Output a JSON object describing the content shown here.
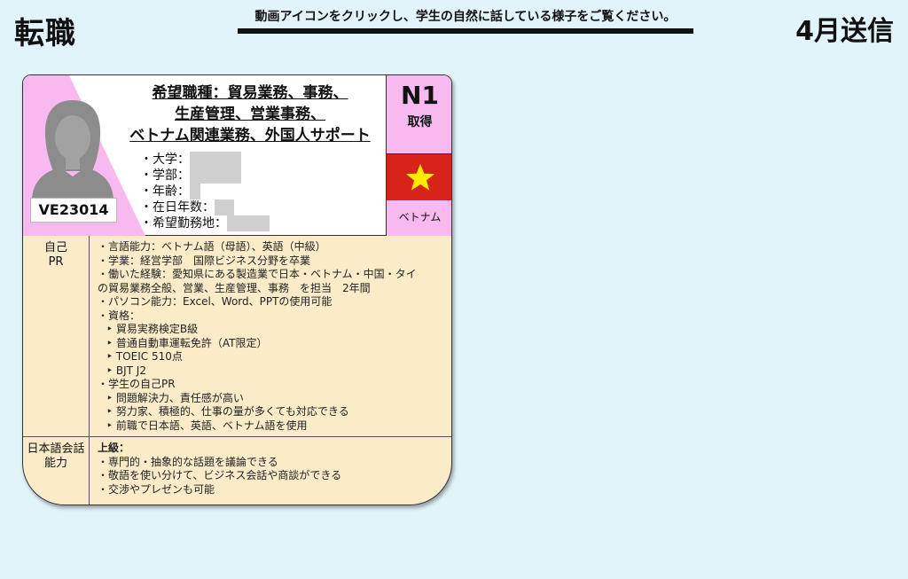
{
  "header": {
    "title": "転職",
    "instruction": "動画アイコンをクリックし、学生の自然に話している様子をご覧ください。",
    "send_month": "4月送信"
  },
  "profile": {
    "student_id": "VE23014",
    "desired_job_lines": [
      "希望職種：貿易業務、事務、",
      "生産管理、営業事務、",
      "ベトナム関連業務、外国人サポート"
    ],
    "info_labels": {
      "university": "・大学：",
      "faculty": "・学部：",
      "age": "・年齢：",
      "years_in_japan": "・在日年数：",
      "desired_location": "・希望勤務地："
    },
    "jlpt_level": "N1",
    "jlpt_status": "取得",
    "country": "ベトナム",
    "flag_colors": {
      "red": "#d8231b",
      "star": "#ffeb00"
    }
  },
  "self_pr": {
    "label_lines": [
      "自己",
      "PR"
    ],
    "lines": [
      "・言語能力：ベトナム語（母語）、英語（中級）",
      "・学業：経営学部　国際ビジネス分野を卒業",
      "・働いた経験：愛知県にある製造業で日本・ベトナム・中国・タイ",
      "の貿易業務全般、営業、生産管理、事務　を担当　2年間",
      "・パソコン能力：Excel、Word、PPTの使用可能",
      "・資格："
    ],
    "certs": [
      "‣ 貿易実務検定B級",
      "‣ 普通自動車運転免許（AT限定）",
      "‣ TOEIC 510点",
      "‣ BJT J2"
    ],
    "student_pr_heading": "・学生の自己PR",
    "student_pr": [
      "‣ 問題解決力、責任感が高い",
      "‣ 努力家、積極的、仕事の量が多くても対応できる",
      "‣ 前職で日本語、英語、ベトナム語を使用"
    ]
  },
  "japanese_ability": {
    "label_lines": [
      "日本語会話",
      "能力"
    ],
    "level": "上級：",
    "lines": [
      "・専門的・抽象的な話題を議論できる",
      "・敬語を使い分けて、ビジネス会話や商談ができる",
      "・交渉やプレゼンも可能"
    ]
  }
}
